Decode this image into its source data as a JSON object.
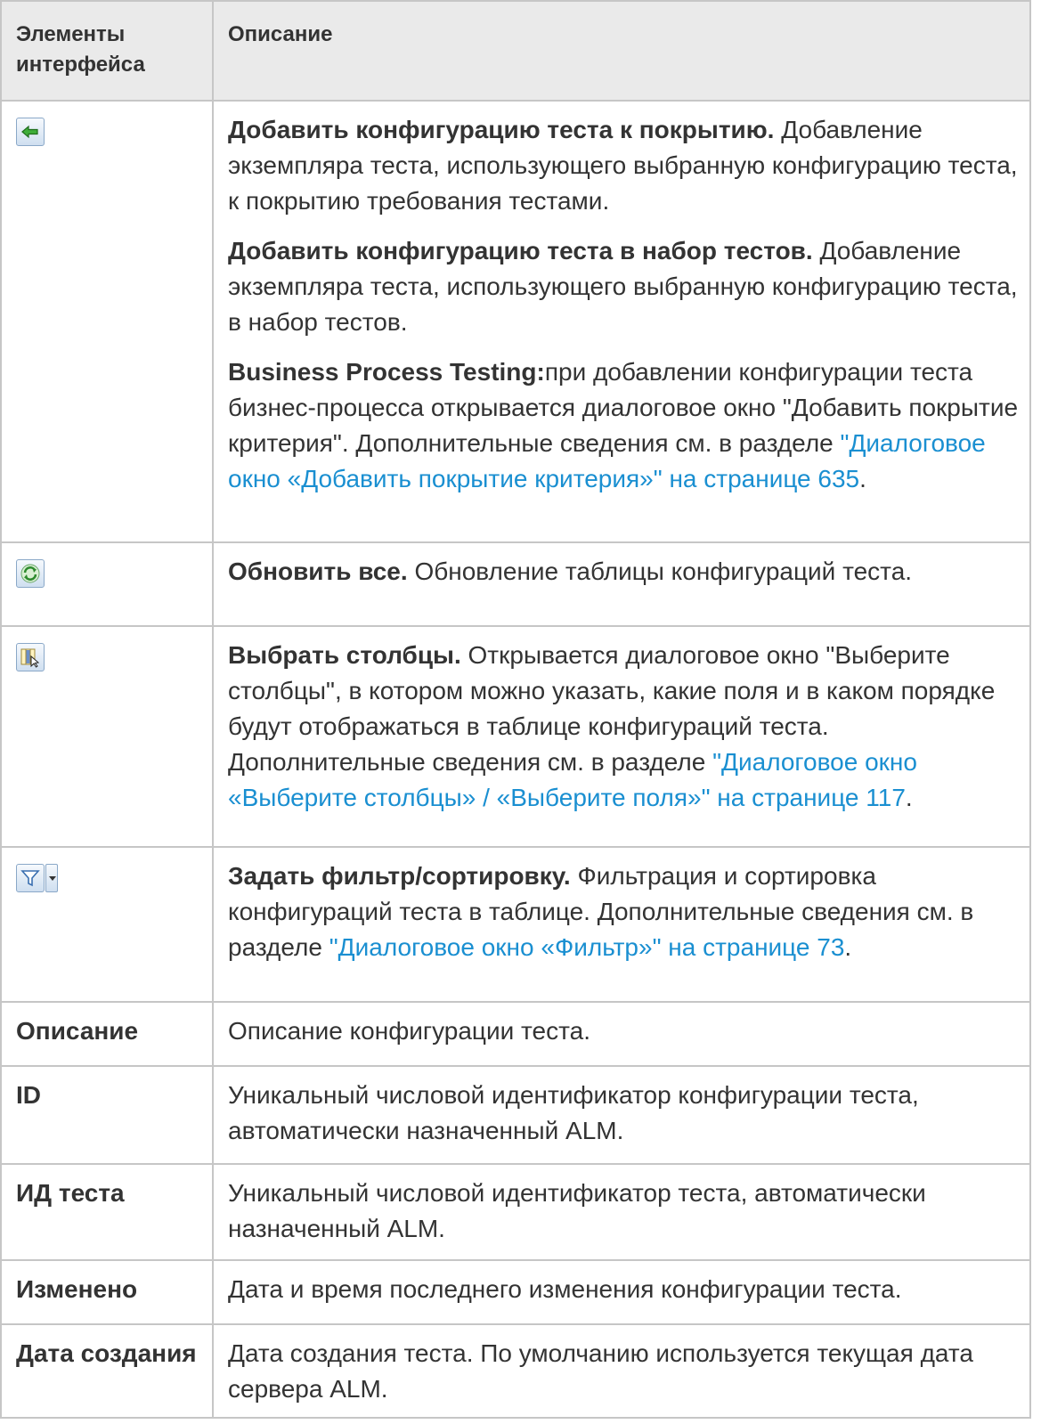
{
  "header": {
    "col1": "Элементы интерфейса",
    "col2": "Описание"
  },
  "rows": {
    "add_config": {
      "icon": "add-configuration-icon",
      "p1_bold": "Добавить конфигурацию теста к покрытию.",
      "p1_text": " Добавление экземпляра теста, использующего выбранную конфигурацию теста, к покрытию требования тестами.",
      "p2_bold": "Добавить конфигурацию теста в набор тестов.",
      "p2_text": " Добавление экземпляра теста, использующего выбранную конфигурацию теста, в набор тестов.",
      "p3_bold": "Business Process Testing:",
      "p3_text": "при добавлении конфигурации теста бизнес-процесса открывается диалоговое окно \"Добавить покрытие критерия\". Дополнительные сведения см. в разделе ",
      "p3_link": "\"Диалоговое окно «Добавить покрытие критерия»\" на странице 635",
      "p3_end": "."
    },
    "refresh": {
      "icon": "refresh-icon",
      "bold": "Обновить все.",
      "text": " Обновление таблицы конфигураций теста."
    },
    "select_columns": {
      "icon": "select-columns-icon",
      "bold": "Выбрать столбцы.",
      "text": " Открывается диалоговое окно \"Выберите столбцы\", в котором можно указать, какие поля и в каком порядке будут отображаться в таблице конфигураций теста. Дополнительные сведения см. в разделе ",
      "link": "\"Диалоговое окно «Выберите столбцы» / «Выберите поля»\" на странице 117",
      "end": "."
    },
    "filter": {
      "icon": "filter-icon",
      "dropdown_icon": "dropdown-arrow-icon",
      "bold": "Задать фильтр/сортировку.",
      "text": " Фильтрация и сортировка конфигураций теста в таблице. Дополнительные сведения см. в разделе ",
      "link": "\"Диалоговое окно «Фильтр»\" на странице 73",
      "end": "."
    },
    "description": {
      "name": "Описание",
      "text": "Описание конфигурации теста."
    },
    "id": {
      "name": "ID",
      "text": "Уникальный числовой идентификатор конфигурации теста, автоматически назначенный ALM."
    },
    "test_id": {
      "name": "ИД теста",
      "text": "Уникальный числовой идентификатор теста, автоматически назначенный ALM."
    },
    "modified": {
      "name": "Изменено",
      "text": "Дата и время последнего изменения конфигурации теста."
    },
    "creation_date": {
      "name": "Дата создания",
      "text": "Дата создания теста. По умолчанию используется текущая дата сервера ALM."
    }
  },
  "colors": {
    "link": "#1a8fd1",
    "header_bg": "#eaeaea",
    "border": "#c6c6c6",
    "text": "#333333"
  }
}
